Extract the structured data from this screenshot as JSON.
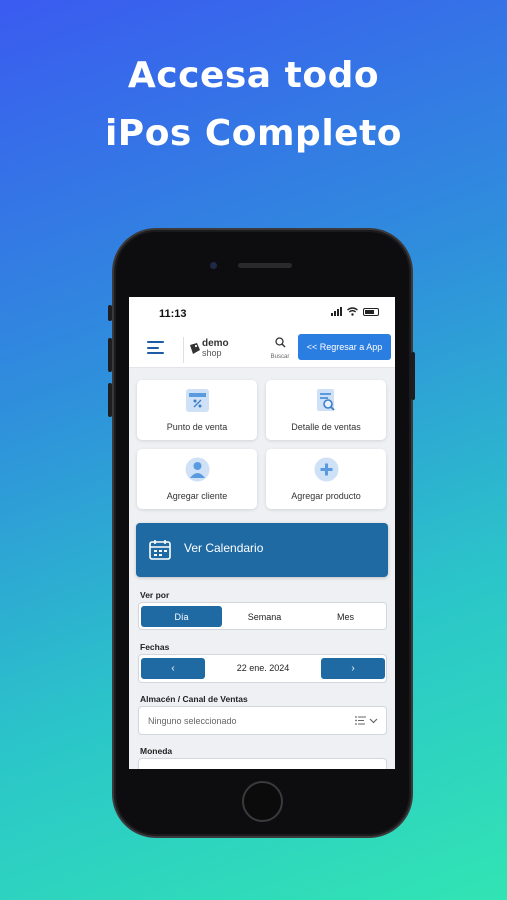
{
  "headline": {
    "line1": "Accesa todo",
    "line2": "iPos Completo"
  },
  "status_bar": {
    "time": "11:13"
  },
  "app_bar": {
    "logo_word1": "demo",
    "logo_word2": "shop",
    "search_label": "Buscar",
    "back_button_label": "<< Regresar a App"
  },
  "quick_actions": [
    {
      "label": "Punto de venta",
      "icon": "percent-tag-icon"
    },
    {
      "label": "Detalle de ventas",
      "icon": "document-search-icon"
    },
    {
      "label": "Agregar cliente",
      "icon": "user-icon"
    },
    {
      "label": "Agregar producto",
      "icon": "plus-circle-icon"
    }
  ],
  "calendar_banner": {
    "label": "Ver Calendario",
    "icon": "calendar-icon"
  },
  "view_by": {
    "label": "Ver por",
    "options": [
      "Día",
      "Semana",
      "Mes"
    ],
    "selected": "Día"
  },
  "dates": {
    "label": "Fechas",
    "prev": "‹",
    "current": "22 ene. 2024",
    "next": "›"
  },
  "warehouse": {
    "label": "Almacén / Canal de Ventas",
    "placeholder": "Ninguno seleccionado"
  },
  "currency": {
    "label": "Moneda"
  },
  "colors": {
    "primary": "#1f6aa3",
    "accent_button": "#2a7de1",
    "icon_tint": "#5a9be0"
  }
}
